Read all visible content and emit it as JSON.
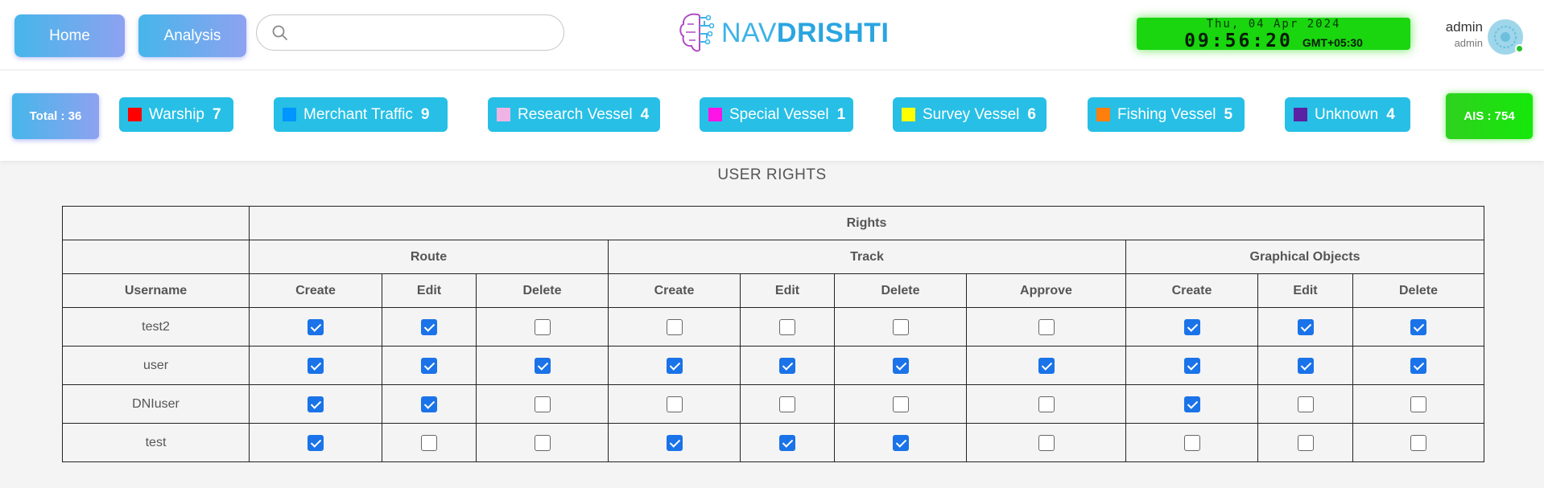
{
  "header": {
    "home_label": "Home",
    "analysis_label": "Analysis",
    "search_placeholder": "",
    "logo_part1": "NAV",
    "logo_part2": "DRISHTI",
    "date": "Thu, 04 Apr 2024",
    "time": "09:56:20",
    "timezone": "GMT+05:30",
    "user_name": "admin",
    "user_role": "admin"
  },
  "stats": {
    "total_label": "Total : 36",
    "ais_label": "AIS : 754",
    "categories": [
      {
        "label": "Warship",
        "count": "7",
        "color": "#ff0000"
      },
      {
        "label": "Merchant Traffic",
        "count": "9",
        "color": "#0095ff"
      },
      {
        "label": "Research Vessel",
        "count": "4",
        "color": "#f0b4e4"
      },
      {
        "label": "Special Vessel",
        "count": "1",
        "color": "#ff14e6"
      },
      {
        "label": "Survey Vessel",
        "count": "6",
        "color": "#ffff00"
      },
      {
        "label": "Fishing Vessel",
        "count": "5",
        "color": "#ff7f0e"
      },
      {
        "label": "Unknown",
        "count": "4",
        "color": "#5b21a3"
      }
    ]
  },
  "rights": {
    "heading": "USER RIGHTS",
    "group_header": "Rights",
    "sections": [
      "Route",
      "Track",
      "Graphical Objects"
    ],
    "username_header": "Username",
    "columns": [
      "Create",
      "Edit",
      "Delete",
      "Create",
      "Edit",
      "Delete",
      "Approve",
      "Create",
      "Edit",
      "Delete"
    ],
    "rows": [
      {
        "username": "test2",
        "checks": [
          true,
          true,
          false,
          false,
          false,
          false,
          false,
          true,
          true,
          true
        ]
      },
      {
        "username": "user",
        "checks": [
          true,
          true,
          true,
          true,
          true,
          true,
          true,
          true,
          true,
          true
        ]
      },
      {
        "username": "DNIuser",
        "checks": [
          true,
          true,
          false,
          false,
          false,
          false,
          false,
          true,
          false,
          false
        ]
      },
      {
        "username": "test",
        "checks": [
          true,
          false,
          false,
          true,
          true,
          true,
          false,
          false,
          false,
          false
        ]
      }
    ]
  }
}
